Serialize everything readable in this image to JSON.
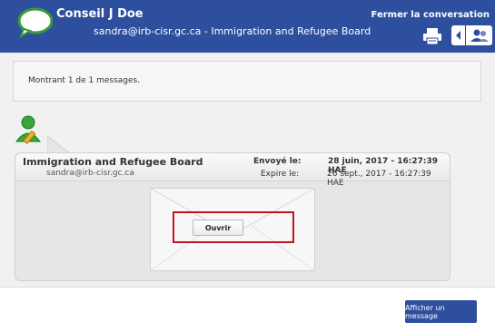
{
  "header": {
    "title": "Conseil J Doe",
    "subtitle": "sandra@irb-cisr.gc.ca - Immigration and Refugee Board",
    "close_label": "Fermer la conversation"
  },
  "messages": {
    "count_text": "Montrant 1 de 1 messages."
  },
  "message": {
    "sender_name": "Immigration and Refugee Board",
    "sender_email": "sandra@irb-cisr.gc.ca",
    "sent_label": "Envoyé le:",
    "sent_value": "28 juin, 2017 - 16:27:39 HAE",
    "expires_label": "Expire le:",
    "expires_value": "26 sept., 2017 - 16:27:39 HAE",
    "open_label": "Ouvrir"
  },
  "footer": {
    "show_message_label": "Afficher un message"
  },
  "colors": {
    "header_bg": "#2d4f9e",
    "highlight": "#c0141f",
    "avatar_green": "#3aa63a"
  },
  "icons": [
    "chat-bubble-icon",
    "printer-icon",
    "back-arrow-icon",
    "contacts-icon",
    "user-avatar-icon",
    "pencil-icon",
    "envelope-icon"
  ]
}
